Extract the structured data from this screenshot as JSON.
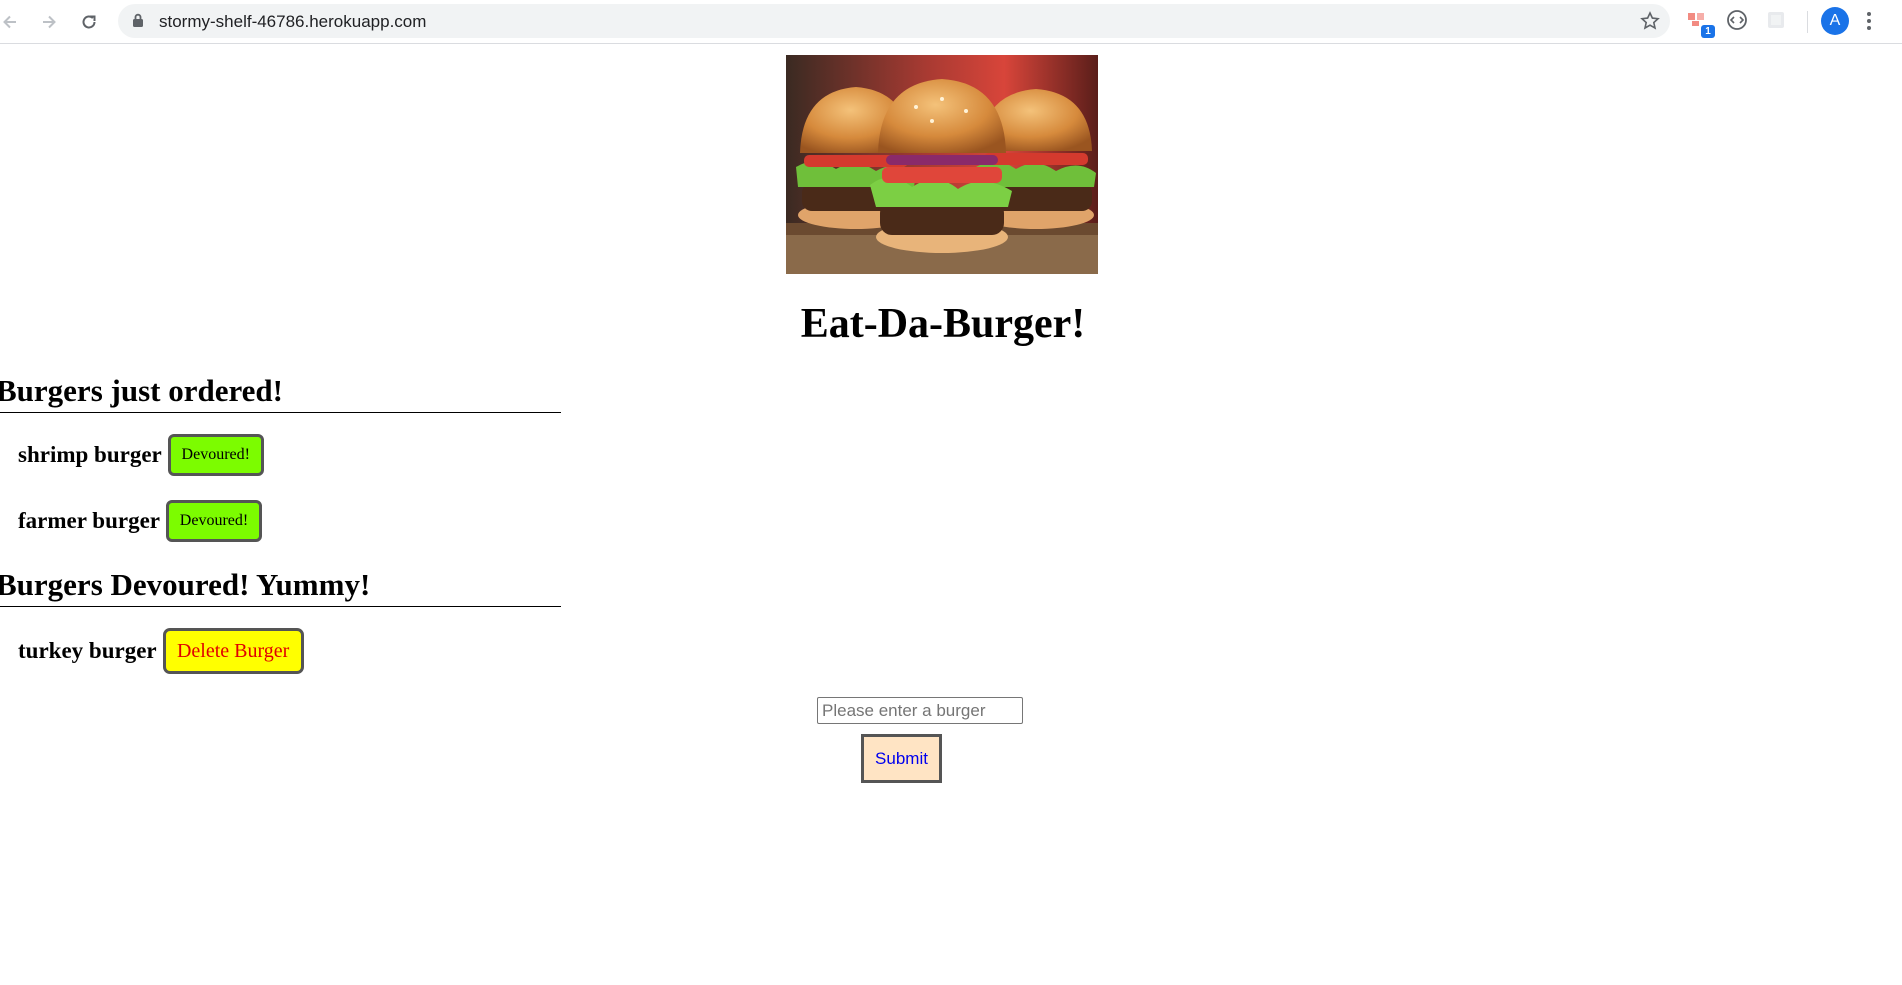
{
  "browser": {
    "url": "stormy-shelf-46786.herokuapp.com",
    "extension_badge": "1",
    "avatar_letter": "A"
  },
  "page": {
    "title": "Eat-Da-Burger!",
    "ordered_section": {
      "heading": "Burgers just ordered!",
      "items": [
        {
          "name": "shrimp burger",
          "button": "Devoured!"
        },
        {
          "name": "farmer burger",
          "button": "Devoured!"
        }
      ]
    },
    "devoured_section": {
      "heading": "Burgers Devoured! Yummy!",
      "items": [
        {
          "name": "turkey burger",
          "button": "Delete Burger"
        }
      ]
    },
    "form": {
      "input_value": "",
      "input_placeholder": "Please enter a burger",
      "submit_label": "Submit"
    }
  },
  "colors": {
    "devour_button": "#7cfc00",
    "delete_button": "#ffff00",
    "delete_text": "#e00000",
    "submit_button": "#ffe4c4",
    "submit_text": "#0000ee"
  }
}
